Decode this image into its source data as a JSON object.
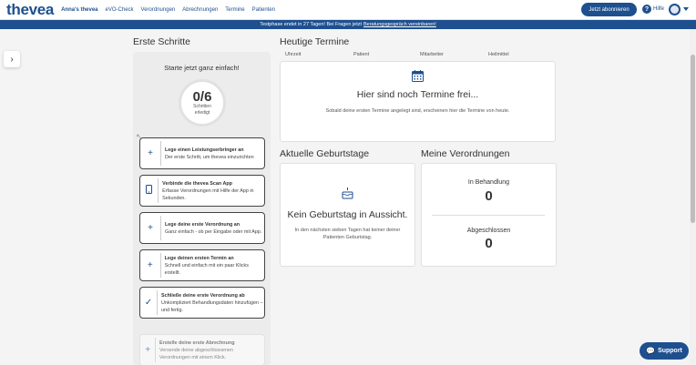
{
  "app": {
    "logo": "thevea"
  },
  "nav": {
    "items": [
      "Anna's thevea",
      "eVO-Check",
      "Verordnungen",
      "Abrechnungen",
      "Termine",
      "Patienten"
    ]
  },
  "header": {
    "subscribe_label": "Jetzt abonnieren",
    "help_label": "Hilfe"
  },
  "banner": {
    "text": "Testphase endet in 27 Tagen! Bei Fragen jetzt",
    "link": "Beratungsgespräch vereinbaren!"
  },
  "steps": {
    "title": "Erste Schritte",
    "intro": "Starte jetzt ganz einfach!",
    "progress_value": "0/6",
    "progress_label_1": "Schritten",
    "progress_label_2": "erledigt",
    "items": [
      {
        "title": "Lege einen Leistungserbringer an",
        "desc": "Der erste Schritt, um thevea einzurichten",
        "icon": "plus-icon"
      },
      {
        "title": "Verbinde die thevea Scan App",
        "desc": "Erfasse Verordnungen mit Hilfe der App in Sekunden.",
        "icon": "phone-icon"
      },
      {
        "title": "Lege deine erste Verordnung an",
        "desc": "Ganz einfach - ob per Eingabe oder mit App.",
        "icon": "plus-icon"
      },
      {
        "title": "Lege deinen ersten Termin an",
        "desc": "Schnell und einfach mit ein paar Klicks erstellt.",
        "icon": "plus-icon"
      },
      {
        "title": "Schließe deine erste Verordnung ab",
        "desc": "Unkompliziert Behandlungsdaten hinzufügen – und fertig.",
        "icon": "check-icon"
      },
      {
        "title": "Erstelle deine erste Abrechnung",
        "desc": "Versende deine abgeschlossenen Verordnungen mit einem Klick.",
        "icon": "plus-icon"
      }
    ]
  },
  "appointments": {
    "title": "Heutige Termine",
    "columns": [
      "Uhrzeit",
      "Patient",
      "Mitarbeiter",
      "Heilmittel"
    ],
    "empty_title": "Hier sind noch Termine frei...",
    "empty_sub": "Sobald deine ersten Termine angelegt sind, erscheinen hier die Termine von heute."
  },
  "birthdays": {
    "title": "Aktuelle Geburtstage",
    "empty_title": "Kein Geburtstag in Aussicht.",
    "empty_sub_1": "In den nächsten sieben Tagen hat keiner deiner",
    "empty_sub_2": "Patienten Geburtstag."
  },
  "prescriptions": {
    "title": "Meine Verordnungen",
    "in_treatment_label": "In Behandlung",
    "in_treatment_value": "0",
    "completed_label": "Abgeschlossen",
    "completed_value": "0"
  },
  "support": {
    "label": "Support"
  },
  "colors": {
    "brand": "#1e4f8f",
    "background": "#f4f4f4"
  }
}
